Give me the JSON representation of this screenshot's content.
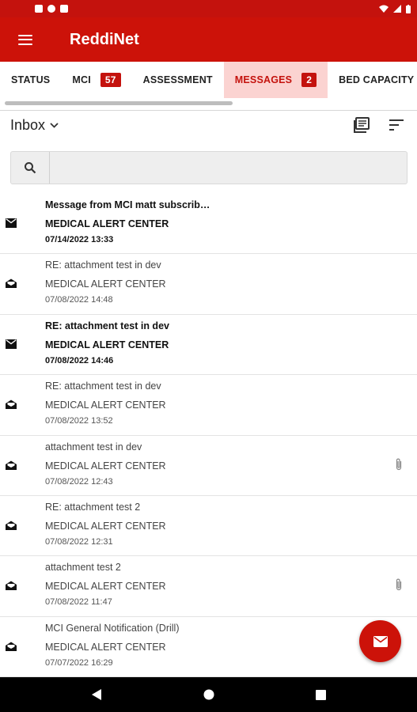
{
  "app": {
    "title": "ReddiNet"
  },
  "colors": {
    "brand": "#cc1209",
    "active_tab_bg": "#fbd3d1"
  },
  "tabs": [
    {
      "label": "STATUS"
    },
    {
      "label": "MCI",
      "badge": "57"
    },
    {
      "label": "ASSESSMENT"
    },
    {
      "label": "MESSAGES",
      "badge": "2",
      "active": true
    },
    {
      "label": "BED CAPACITY"
    }
  ],
  "toolbar": {
    "folder": "Inbox",
    "icons": [
      "mark-all-read-icon",
      "sort-icon"
    ]
  },
  "search": {
    "placeholder": "",
    "value": ""
  },
  "messages": [
    {
      "subject": "Message from MCI matt subscribe c...",
      "from": "MEDICAL ALERT CENTER",
      "date": "07/14/2022 13:33",
      "unread": true,
      "attachment": false
    },
    {
      "subject": "RE: attachment test in dev",
      "from": "MEDICAL ALERT CENTER",
      "date": "07/08/2022 14:48",
      "unread": false,
      "attachment": false
    },
    {
      "subject": "RE: attachment test in dev",
      "from": "MEDICAL ALERT CENTER",
      "date": "07/08/2022 14:46",
      "unread": true,
      "attachment": false
    },
    {
      "subject": "RE: attachment test in dev",
      "from": "MEDICAL ALERT CENTER",
      "date": "07/08/2022 13:52",
      "unread": false,
      "attachment": false
    },
    {
      "subject": "attachment test in dev",
      "from": "MEDICAL ALERT CENTER",
      "date": "07/08/2022 12:43",
      "unread": false,
      "attachment": true
    },
    {
      "subject": "RE: attachment test 2",
      "from": "MEDICAL ALERT CENTER",
      "date": "07/08/2022 12:31",
      "unread": false,
      "attachment": false
    },
    {
      "subject": "attachment test 2",
      "from": "MEDICAL ALERT CENTER",
      "date": "07/08/2022 11:47",
      "unread": false,
      "attachment": true
    },
    {
      "subject": "MCI General Notification (Drill)",
      "from": "MEDICAL ALERT CENTER",
      "date": "07/07/2022 16:29",
      "unread": false,
      "attachment": false
    }
  ],
  "fab": {
    "icon": "compose-mail-icon"
  },
  "nav": {
    "icons": [
      "back-icon",
      "home-icon",
      "recents-icon"
    ]
  }
}
